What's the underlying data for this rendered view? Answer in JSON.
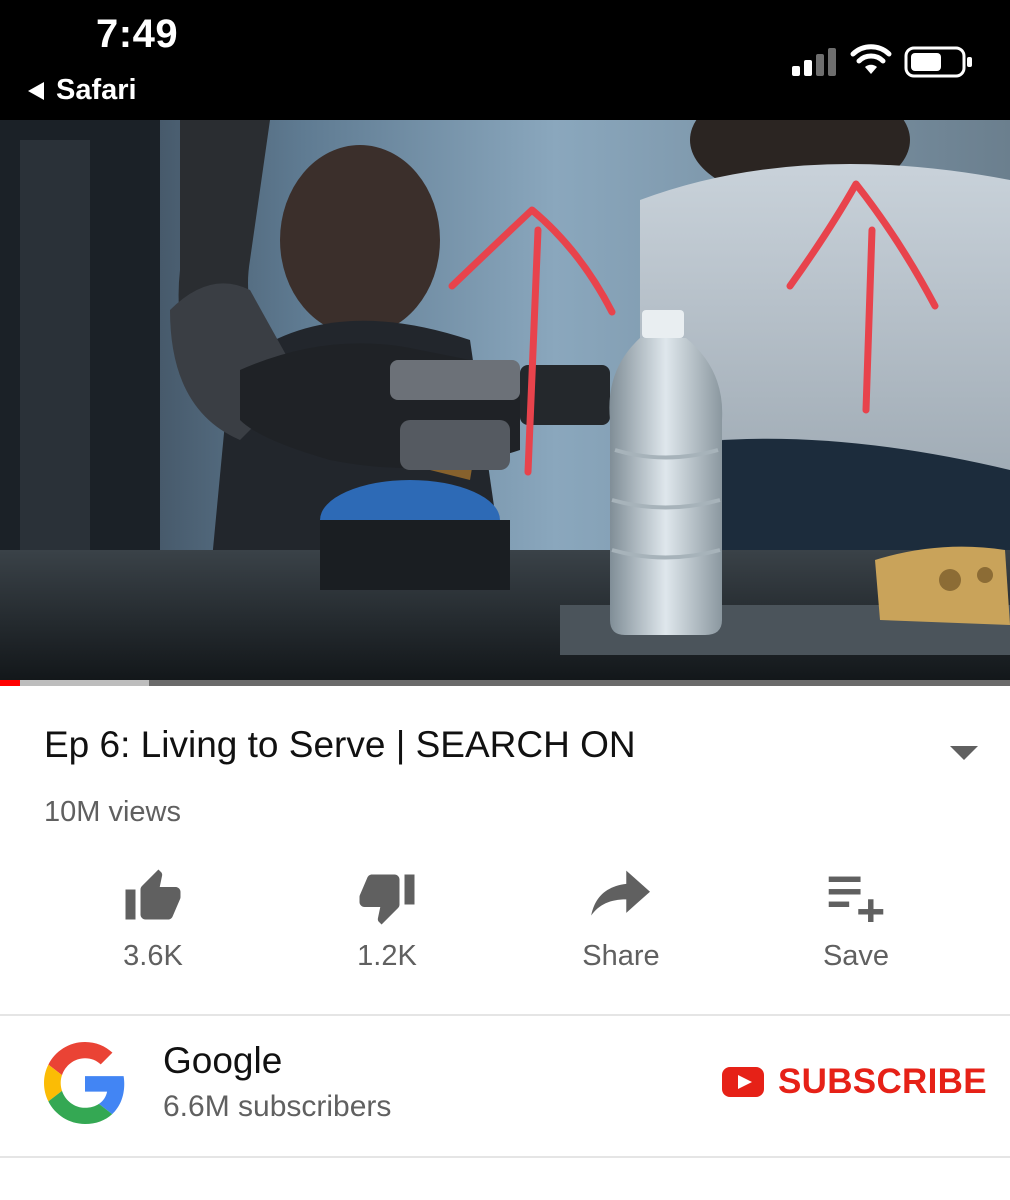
{
  "status_bar": {
    "time": "7:49",
    "back_app": "Safari",
    "icons": [
      "cellular-signal-icon",
      "wifi-icon",
      "battery-icon"
    ]
  },
  "video": {
    "progress_fraction": 0.02,
    "buffered_fraction": 0.148,
    "colors": {
      "progress": "#ff0000",
      "annotation": "#e8434c"
    }
  },
  "details": {
    "title": "Ep 6: Living to Serve | SEARCH ON",
    "views": "10M views"
  },
  "actions": [
    {
      "icon": "thumbs-up-icon",
      "label": "3.6K"
    },
    {
      "icon": "thumbs-down-icon",
      "label": "1.2K"
    },
    {
      "icon": "share-icon",
      "label": "Share"
    },
    {
      "icon": "playlist-add-icon",
      "label": "Save"
    }
  ],
  "channel": {
    "name": "Google",
    "subscribers": "6.6M subscribers",
    "subscribe_label": "SUBSCRIBE",
    "subscribe_color": "#e62117"
  }
}
